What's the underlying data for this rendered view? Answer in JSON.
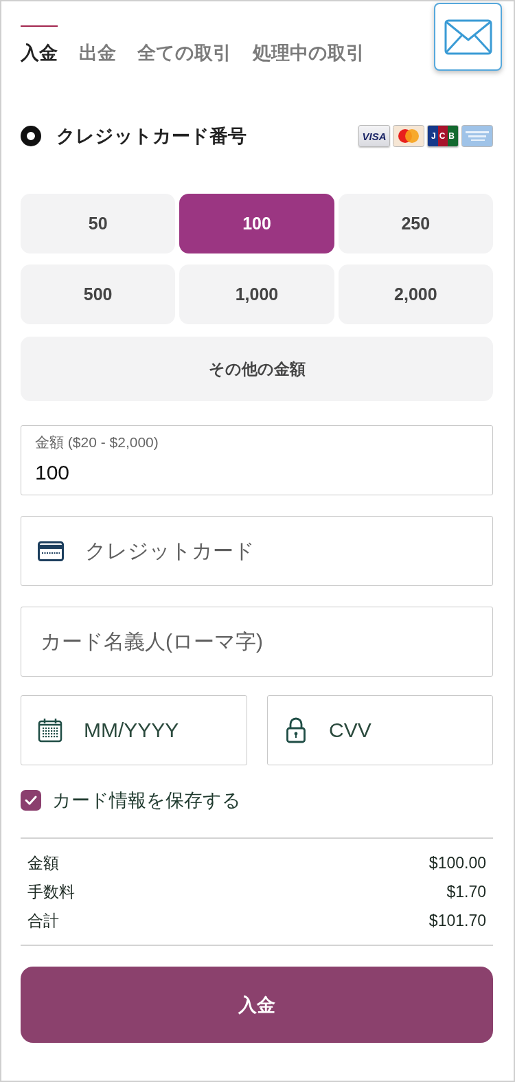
{
  "tabs": [
    {
      "label": "入金",
      "selected": true
    },
    {
      "label": "出金",
      "selected": false
    },
    {
      "label": "全ての取引",
      "selected": false
    },
    {
      "label": "処理中の取引",
      "selected": false
    }
  ],
  "payment_method": {
    "label": "クレジットカード番号",
    "selected": true,
    "card_brands": [
      {
        "kind": "visa",
        "label": "VISA"
      },
      {
        "kind": "mastercard"
      },
      {
        "kind": "jcb",
        "label": "JCB"
      },
      {
        "kind": "amex"
      }
    ]
  },
  "amount_presets": [
    {
      "label": "50",
      "selected": false
    },
    {
      "label": "100",
      "selected": true
    },
    {
      "label": "250",
      "selected": false
    },
    {
      "label": "500",
      "selected": false
    },
    {
      "label": "1,000",
      "selected": false
    },
    {
      "label": "2,000",
      "selected": false
    }
  ],
  "other_amount": {
    "label": "その他の金額"
  },
  "amount_field": {
    "label": "金額 ($20 - $2,000)",
    "value": "100"
  },
  "card_number_field": {
    "placeholder": "クレジットカード"
  },
  "cardholder_field": {
    "placeholder": "カード名義人(ローマ字)"
  },
  "expiry_field": {
    "placeholder": "MM/YYYY"
  },
  "cvv_field": {
    "placeholder": "CVV"
  },
  "save_card": {
    "label": "カード情報を保存する",
    "checked": true
  },
  "summary": [
    {
      "label": "金額",
      "value": "$100.00"
    },
    {
      "label": "手数料",
      "value": "$1.70"
    },
    {
      "label": "合計",
      "value": "$101.70"
    }
  ],
  "submit_button": {
    "label": "入金"
  }
}
